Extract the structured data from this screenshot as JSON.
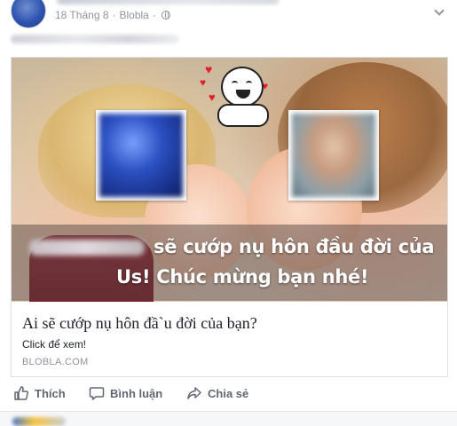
{
  "post": {
    "date": "18 Tháng 8",
    "app": "Blobla"
  },
  "card": {
    "overlay_line1": "sẽ cướp nụ hôn đầu đời của",
    "overlay_line2": "Us! Chúc mừng bạn nhé!",
    "title": "Ai sẽ cướp nụ hôn đầ`u đời của bạn?",
    "description": "Click để xem!",
    "domain": "BLOBLA.COM"
  },
  "actions": {
    "like": "Thích",
    "comment": "Bình luận",
    "share": "Chia sẻ"
  },
  "colors": {
    "meta_gray": "#90949c",
    "action_gray": "#606770",
    "heart_red": "#e0212c"
  }
}
